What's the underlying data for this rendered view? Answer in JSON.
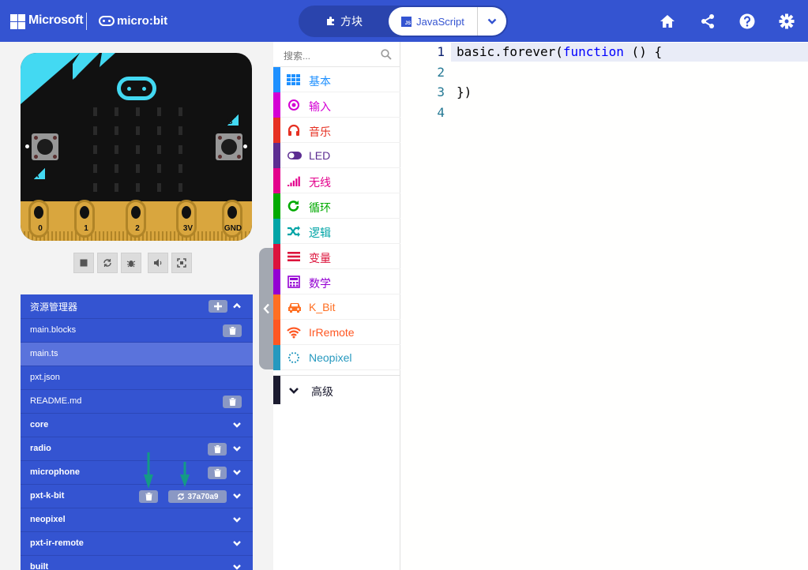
{
  "header": {
    "brand": "Microsoft",
    "product": "micro:bit",
    "mode_blocks": "方块",
    "mode_js": "JavaScript",
    "js_badge": "JS",
    "icons": [
      "home-icon",
      "share-icon",
      "help-icon",
      "settings-icon"
    ]
  },
  "simulator": {
    "pins": [
      "0",
      "1",
      "2",
      "3V",
      "GND"
    ],
    "button_a": "A",
    "button_b": "B",
    "tools": [
      "stop-icon",
      "restart-icon",
      "debug-icon",
      "mute-icon",
      "fullscreen-icon"
    ]
  },
  "explorer": {
    "title": "资源管理器",
    "files": [
      {
        "name": "main.blocks",
        "deletable": true
      },
      {
        "name": "main.ts",
        "active": true
      },
      {
        "name": "pxt.json"
      },
      {
        "name": "README.md",
        "deletable": true
      }
    ],
    "packages": [
      {
        "name": "core"
      },
      {
        "name": "radio",
        "deletable": true
      },
      {
        "name": "microphone",
        "deletable": true
      },
      {
        "name": "pxt-k-bit",
        "deletable": true,
        "sync": "37a70a9"
      },
      {
        "name": "neopixel"
      },
      {
        "name": "pxt-ir-remote"
      },
      {
        "name": "built"
      }
    ]
  },
  "toolbox": {
    "search_placeholder": "搜索...",
    "categories": [
      {
        "label": "基本",
        "color": "#1e90ff",
        "icon": "grid-icon"
      },
      {
        "label": "输入",
        "color": "#d400d4",
        "icon": "target-icon"
      },
      {
        "label": "音乐",
        "color": "#e63022",
        "icon": "headphones-icon"
      },
      {
        "label": "LED",
        "color": "#5c2d91",
        "icon": "toggle-icon"
      },
      {
        "label": "无线",
        "color": "#e3008c",
        "icon": "signal-icon"
      },
      {
        "label": "循环",
        "color": "#00aa00",
        "icon": "refresh-icon"
      },
      {
        "label": "逻辑",
        "color": "#00a4a6",
        "icon": "shuffle-icon"
      },
      {
        "label": "变量",
        "color": "#dc143c",
        "icon": "list-icon"
      },
      {
        "label": "数学",
        "color": "#9400d3",
        "icon": "calculator-icon"
      },
      {
        "label": "K_Bit",
        "color": "#ff6f22",
        "icon": "car-icon"
      },
      {
        "label": "IrRemote",
        "color": "#ff5722",
        "icon": "wifi-icon"
      },
      {
        "label": "Neopixel",
        "color": "#2699bf",
        "icon": "circle-dots-icon"
      }
    ],
    "advanced": "高级",
    "advanced_color": "#1b1b2f"
  },
  "editor": {
    "line_numbers": [
      "1",
      "2",
      "3",
      "4"
    ],
    "line1_a": "basic.forever(",
    "line1_kw": "function",
    "line1_b": " () {",
    "line3": "})"
  }
}
